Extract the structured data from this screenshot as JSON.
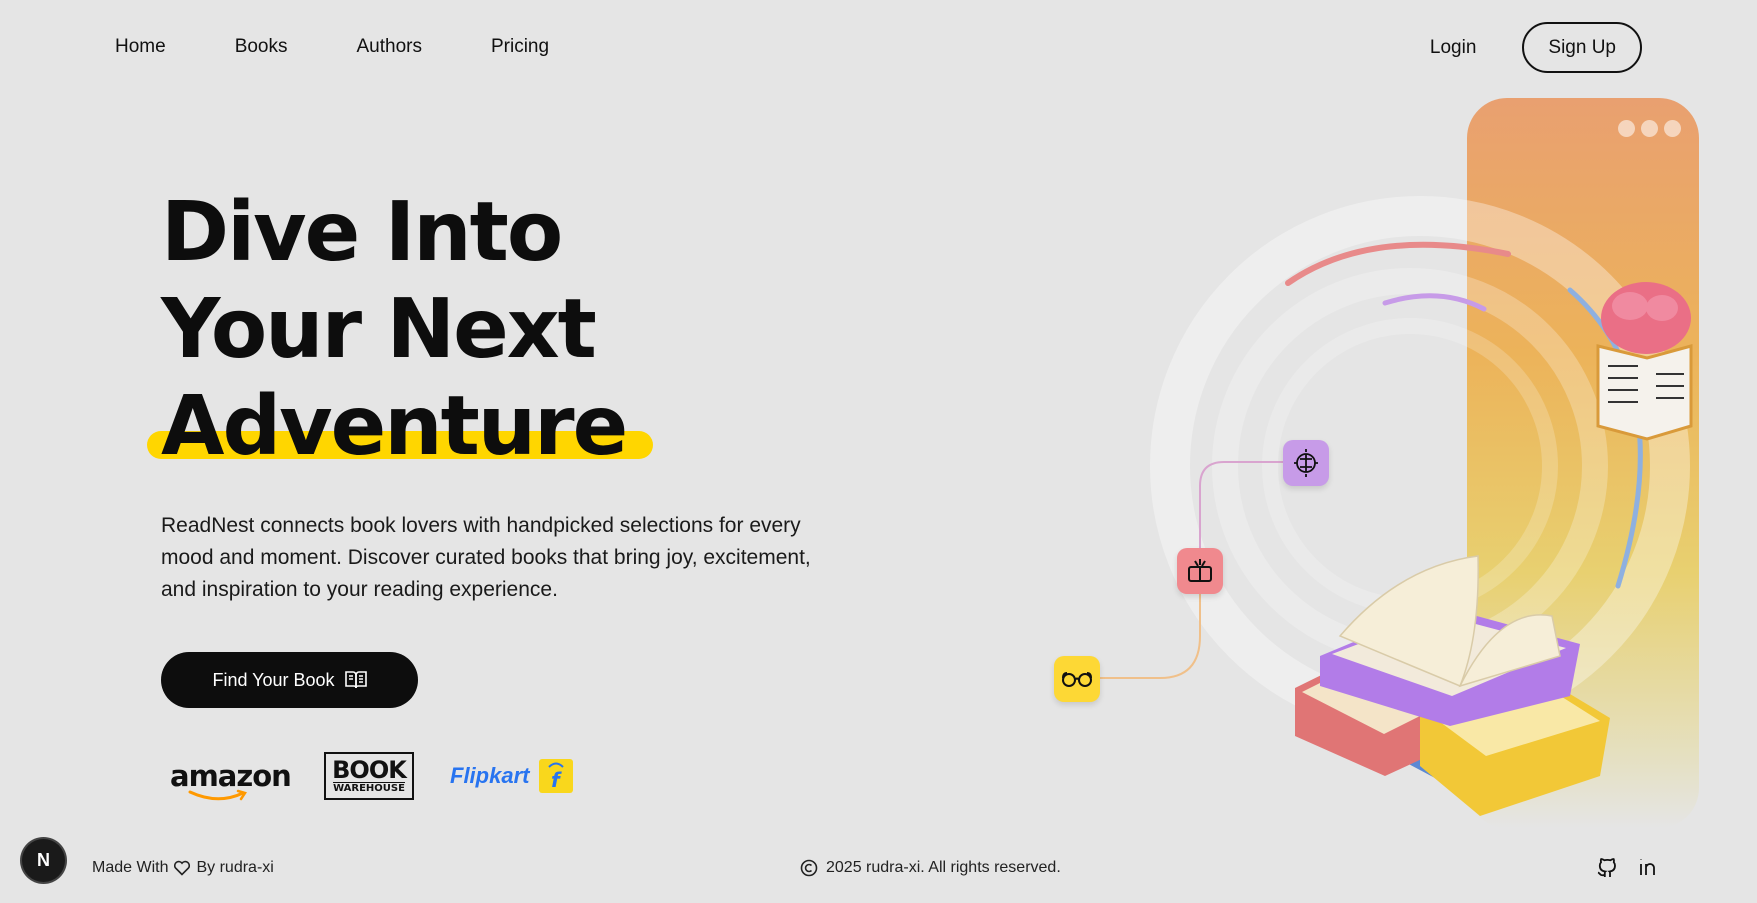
{
  "nav": {
    "links": [
      "Home",
      "Books",
      "Authors",
      "Pricing"
    ],
    "login": "Login",
    "signup": "Sign Up"
  },
  "hero": {
    "title_lines": [
      "Dive Into",
      "Your Next",
      "Adventure"
    ],
    "description": "ReadNest connects book lovers with handpicked selections for every mood and moment. Discover curated books that bring joy, excitement, and inspiration to your reading experience.",
    "cta": "Find Your Book"
  },
  "partners": {
    "amazon": "amazon",
    "book_warehouse_top": "BOOK",
    "book_warehouse_bottom": "WAREHOUSE",
    "flipkart": "Flipkart"
  },
  "footer": {
    "badge": "N",
    "made_with": "Made With",
    "by": "By rudra-xi",
    "copyright": "2025 rudra-xi. All rights reserved."
  },
  "colors": {
    "accent": "#ffd600",
    "background": "#e5e5e5",
    "dark": "#0d0d0d"
  },
  "icons": {
    "cta": "open-book-icon",
    "nodes": [
      "glasses-icon",
      "tv-book-icon",
      "brain-icon"
    ],
    "socials": [
      "github-icon",
      "linkedin-icon"
    ]
  }
}
